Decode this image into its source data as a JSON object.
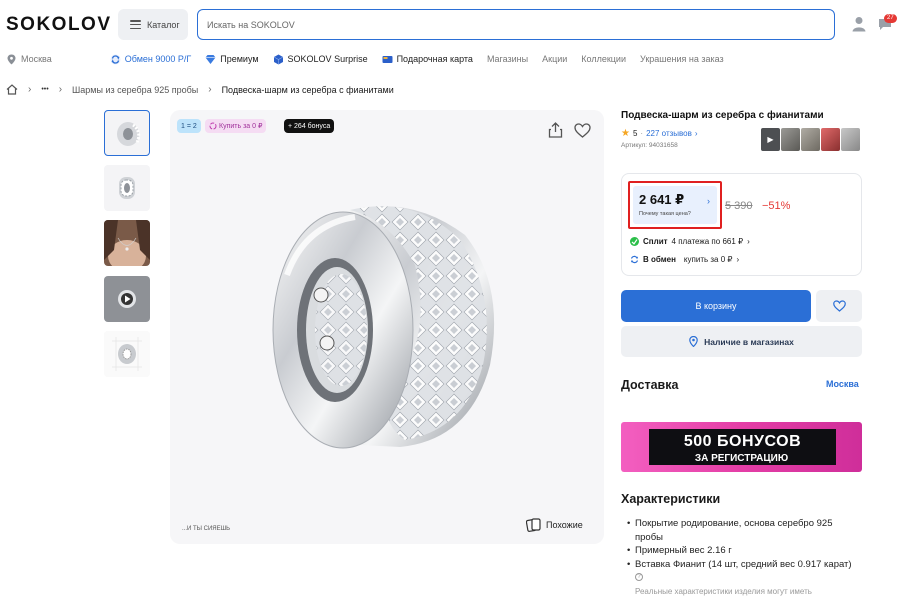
{
  "header": {
    "logo": "SOKOLOV",
    "catalog_label": "Каталог",
    "search_placeholder": "Искать на SOKOLOV",
    "notifications_count": "27"
  },
  "subnav": {
    "city": "Москва",
    "items": [
      {
        "label": "Обмен 9000 Р/Г",
        "style": "blue"
      },
      {
        "label": "Премиум",
        "style": "dark"
      },
      {
        "label": "SOKOLOV Surprise",
        "style": "dark"
      },
      {
        "label": "Подарочная карта",
        "style": "dark"
      },
      {
        "label": "Магазины",
        "style": "gray"
      },
      {
        "label": "Акции",
        "style": "gray"
      },
      {
        "label": "Коллекции",
        "style": "gray"
      },
      {
        "label": "Украшения на заказ",
        "style": "gray"
      }
    ]
  },
  "breadcrumb": {
    "ellipsis": "•••",
    "level1": "Шармы из серебра 925 пробы",
    "current": "Подвеска-шарм из серебра с фианитами"
  },
  "gallery": {
    "tags": [
      "1 = 2",
      "Купить за 0 ₽",
      "+ 264 бонуса"
    ],
    "caption": "...И ТЫ СИЯЕШЬ",
    "similar_label": "Похожие"
  },
  "product": {
    "title": "Подвеска-шарм из серебра с фианитами",
    "rating": "5",
    "reviews_link": "227 отзывов",
    "article": "Артикул: 94031658"
  },
  "price": {
    "current": "2 641 ₽",
    "hint": "Почему такая цена?",
    "old": "5 390",
    "discount": "−51%",
    "split_brand": "Сплит",
    "split_text": "4 платежа по 661 ₽",
    "exchange_brand": "В обмен",
    "exchange_text": "купить за 0 ₽"
  },
  "actions": {
    "cart_label": "В корзину",
    "stores_label": "Наличие в магазинах"
  },
  "delivery": {
    "title": "Доставка",
    "city": "Москва"
  },
  "banner": {
    "line1": "500 БОНУСОВ",
    "line2": "ЗА РЕГИСТРАЦИЮ"
  },
  "characteristics": {
    "title": "Характеристики",
    "items": [
      "Покрытие родирование, основа серебро 925 пробы",
      "Примерный вес 2.16 г",
      "Вставка Фианит (14 шт, средний вес 0.917 карат)"
    ],
    "note": "Реальные характеристики изделия могут иметь"
  },
  "colors": {
    "accent": "#2b6fd6",
    "discount": "#e53935",
    "highlight_border": "#e02020",
    "banner_pink": "#e43ea6"
  }
}
